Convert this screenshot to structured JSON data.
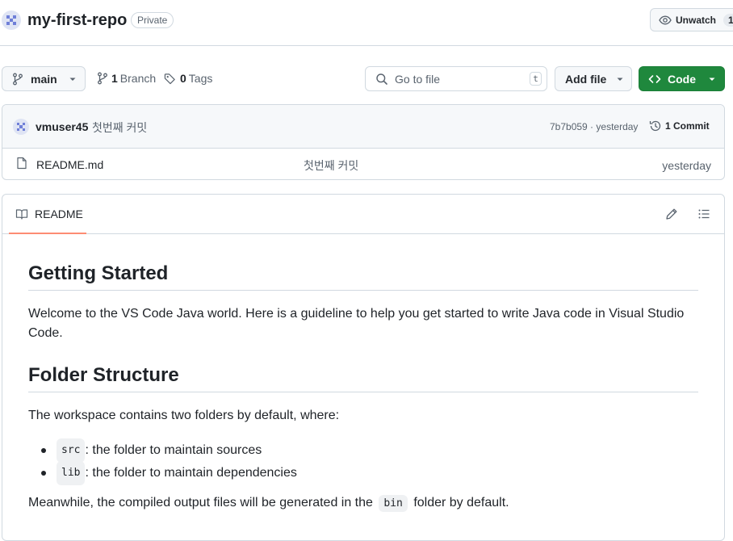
{
  "repo": {
    "name": "my-first-repo",
    "visibility": "Private"
  },
  "watch": {
    "label": "Unwatch",
    "count": "1"
  },
  "branch": {
    "name": "main",
    "branch_count": "1",
    "branch_label": "Branch",
    "tag_count": "0",
    "tag_label": "Tags"
  },
  "search": {
    "placeholder": "Go to file",
    "shortcut": "t"
  },
  "add_file_label": "Add file",
  "code_label": "Code",
  "commit": {
    "author": "vmuser45",
    "message": "첫번째 커밋",
    "sha": "7b7b059",
    "time": "yesterday",
    "count_label": "1 Commit"
  },
  "files": [
    {
      "name": "README.md",
      "message": "첫번째 커밋",
      "time": "yesterday"
    }
  ],
  "readme": {
    "tab_label": "README",
    "h1": "Getting Started",
    "p1": "Welcome to the VS Code Java world. Here is a guideline to help you get started to write Java code in Visual Studio Code.",
    "h2": "Folder Structure",
    "p2": "The workspace contains two folders by default, where:",
    "items": [
      {
        "code": "src",
        "text": ": the folder to maintain sources"
      },
      {
        "code": "lib",
        "text": ": the folder to maintain dependencies"
      }
    ],
    "p3_before": "Meanwhile, the compiled output files will be generated in the",
    "p3_code": "bin",
    "p3_after": "folder by default."
  }
}
